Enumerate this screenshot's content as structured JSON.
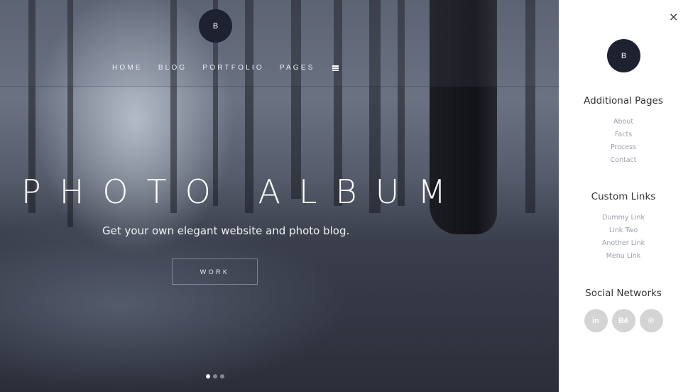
{
  "header": {
    "logo_letter": "B",
    "nav": [
      {
        "label": "HOME"
      },
      {
        "label": "BLOG"
      },
      {
        "label": "PORTFOLIO"
      },
      {
        "label": "PAGES"
      }
    ],
    "menu_icon": "hamburger-icon"
  },
  "hero": {
    "title": "PHOTO ALBUM",
    "subtitle": "Get your own elegant website and photo blog.",
    "button_label": "WORK",
    "slides": {
      "count": 3,
      "active_index": 0
    }
  },
  "sidebar": {
    "close_icon": "×",
    "logo_letter": "B",
    "sections": [
      {
        "title": "Additional Pages",
        "items": [
          "About",
          "Facts",
          "Process",
          "Contact"
        ]
      },
      {
        "title": "Custom Links",
        "items": [
          "Dummy Link",
          "Link Two",
          "Another Link",
          "Menu Link"
        ]
      }
    ],
    "social": {
      "title": "Social Networks",
      "items": [
        {
          "name": "linkedin",
          "glyph": "in"
        },
        {
          "name": "behance",
          "glyph": "Bē"
        },
        {
          "name": "pinterest",
          "glyph": "℗"
        }
      ]
    }
  }
}
